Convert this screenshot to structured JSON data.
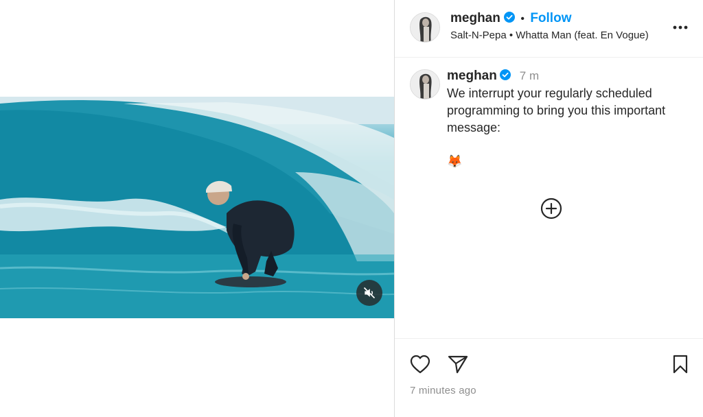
{
  "post": {
    "author": "meghan",
    "follow_label": "Follow",
    "separator": "•",
    "audio": "Salt-N-Pepa • Whatta Man (feat. En Vogue)",
    "more_icon": "more-horizontal-icon"
  },
  "caption": {
    "author": "meghan",
    "age": "7 m",
    "text": "We interrupt your regularly scheduled programming to bring you this important message:",
    "emoji": "🦊"
  },
  "media": {
    "type": "video",
    "description": "surfer-riding-wave",
    "muted": true,
    "mute_icon": "speaker-muted-icon"
  },
  "actions": {
    "like_icon": "heart-icon",
    "share_icon": "paper-plane-icon",
    "save_icon": "bookmark-icon",
    "load_more_icon": "plus-circle-icon"
  },
  "timestamp": "7 minutes ago",
  "colors": {
    "accent": "#0095f6",
    "verified": "#0095f6",
    "text": "#262626",
    "muted_text": "#8e8e8e"
  }
}
